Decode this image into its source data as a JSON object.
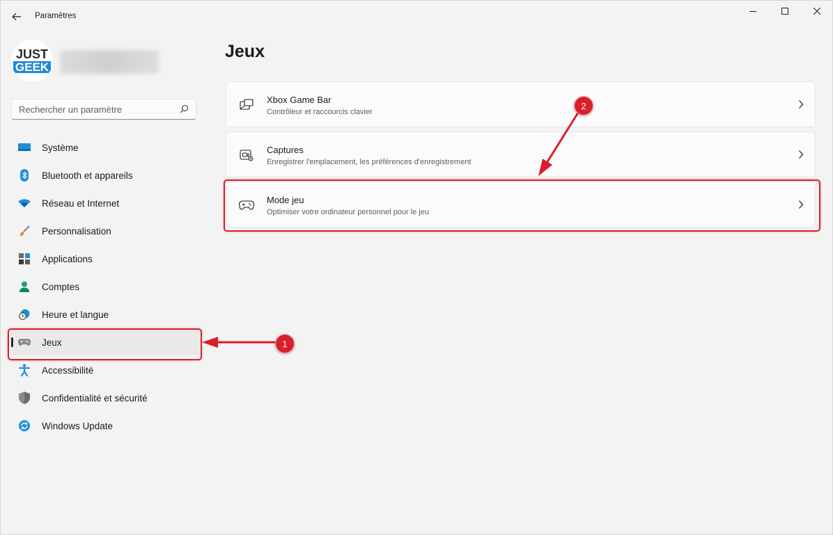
{
  "window": {
    "title": "Paramètres",
    "back_icon": "back-arrow-icon",
    "controls": [
      "minimize-icon",
      "maximize-icon",
      "close-icon"
    ]
  },
  "profile": {
    "logo_text_line1": "JUST",
    "logo_text_line2": "GEEK"
  },
  "search": {
    "placeholder": "Rechercher un paramètre",
    "icon": "search-icon"
  },
  "sidebar": {
    "items": [
      {
        "label": "Système",
        "icon": "system-icon",
        "active": false
      },
      {
        "label": "Bluetooth et appareils",
        "icon": "bluetooth-icon",
        "active": false
      },
      {
        "label": "Réseau et Internet",
        "icon": "wifi-icon",
        "active": false
      },
      {
        "label": "Personnalisation",
        "icon": "brush-icon",
        "active": false
      },
      {
        "label": "Applications",
        "icon": "apps-icon",
        "active": false
      },
      {
        "label": "Comptes",
        "icon": "account-icon",
        "active": false
      },
      {
        "label": "Heure et langue",
        "icon": "clock-globe-icon",
        "active": false
      },
      {
        "label": "Jeux",
        "icon": "gamepad-icon",
        "active": true
      },
      {
        "label": "Accessibilité",
        "icon": "accessibility-icon",
        "active": false
      },
      {
        "label": "Confidentialité et sécurité",
        "icon": "shield-icon",
        "active": false
      },
      {
        "label": "Windows Update",
        "icon": "update-icon",
        "active": false
      }
    ]
  },
  "main": {
    "title": "Jeux",
    "cards": [
      {
        "title": "Xbox Game Bar",
        "subtitle": "Contrôleur et raccourcis clavier",
        "icon": "game-bar-icon"
      },
      {
        "title": "Captures",
        "subtitle": "Enregistrer l'emplacement, les préférences d'enregistrement",
        "icon": "capture-icon"
      },
      {
        "title": "Mode jeu",
        "subtitle": "Optimiser votre ordinateur personnel pour le jeu",
        "icon": "gamepad-icon"
      }
    ]
  },
  "annotations": {
    "step1": "1",
    "step2": "2",
    "color": "#d9202a"
  },
  "colors": {
    "background": "#f3f3f3",
    "card": "#fbfbfb",
    "accent": "#0067c0"
  }
}
